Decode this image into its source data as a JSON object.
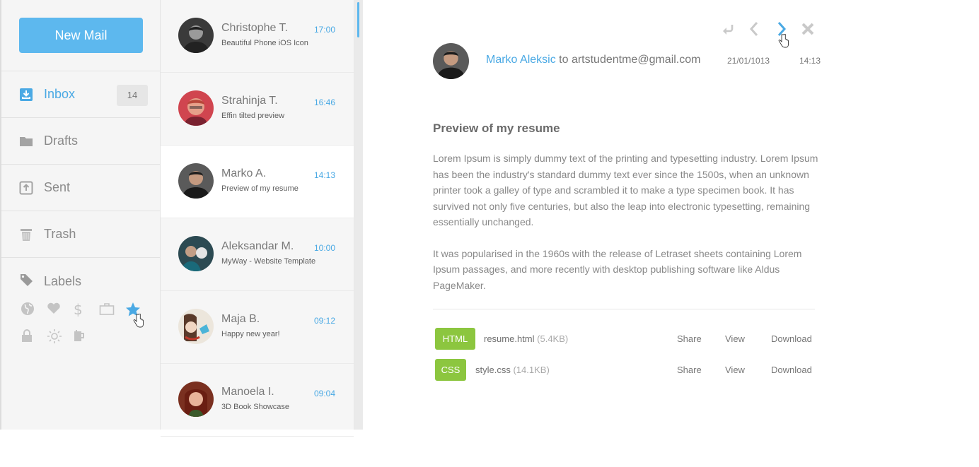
{
  "sidebar": {
    "new_mail_label": "New Mail",
    "nav": [
      {
        "label": "Inbox",
        "count": "14",
        "icon": "inbox-icon",
        "active": true
      },
      {
        "label": "Drafts",
        "icon": "folder-icon"
      },
      {
        "label": "Sent",
        "icon": "sent-icon"
      },
      {
        "label": "Trash",
        "icon": "trash-icon"
      }
    ],
    "labels_title": "Labels",
    "label_icons": [
      "globe-icon",
      "heart-icon",
      "dollar-icon",
      "briefcase-icon",
      "star-icon",
      "lock-icon",
      "sun-icon",
      "coffee-icon"
    ]
  },
  "mails": [
    {
      "name": "Christophe T.",
      "subject": "Beautiful Phone iOS Icon",
      "time": "17:00"
    },
    {
      "name": "Strahinja T.",
      "subject": "Effin tilted preview",
      "time": "16:46"
    },
    {
      "name": "Marko A.",
      "subject": "Preview of my resume",
      "time": "14:13"
    },
    {
      "name": "Aleksandar M.",
      "subject": "MyWay - Website Template",
      "time": "10:00"
    },
    {
      "name": "Maja B.",
      "subject": "Happy new year!",
      "time": "09:12"
    },
    {
      "name": "Manoela I.",
      "subject": "3D Book Showcase",
      "time": "09:04"
    }
  ],
  "reader": {
    "toolbar": [
      "reply-icon",
      "previous-icon",
      "next-icon",
      "close-icon"
    ],
    "sender": "Marko Aleksic",
    "to_text": " to artstudentme@gmail.com",
    "date": "21/01/1013",
    "time": "14:13",
    "subject": "Preview of my resume",
    "body_p1": "Lorem Ipsum is simply dummy text of the printing and typesetting industry. Lorem Ipsum has been the industry's standard dummy text ever since the 1500s, when an unknown printer took a galley of type and scrambled it to make a type specimen book. It has survived not only five centuries, but also the leap into electronic typesetting, remaining essentially unchanged.",
    "body_p2": "It was popularised in the 1960s with the release of Letraset sheets containing Lorem Ipsum passages, and more recently with desktop publishing software like Aldus PageMaker.",
    "attachments": [
      {
        "type": "HTML",
        "name": "resume.html",
        "size": "(5.4KB)",
        "share": "Share",
        "view": "View",
        "download": "Download"
      },
      {
        "type": "CSS",
        "name": "style.css",
        "size": "(14.1KB)",
        "share": "Share",
        "view": "View",
        "download": "Download"
      }
    ]
  },
  "colors": {
    "accent": "#5db8ee",
    "link": "#4aa9e4",
    "badge": "#8cc63f"
  }
}
